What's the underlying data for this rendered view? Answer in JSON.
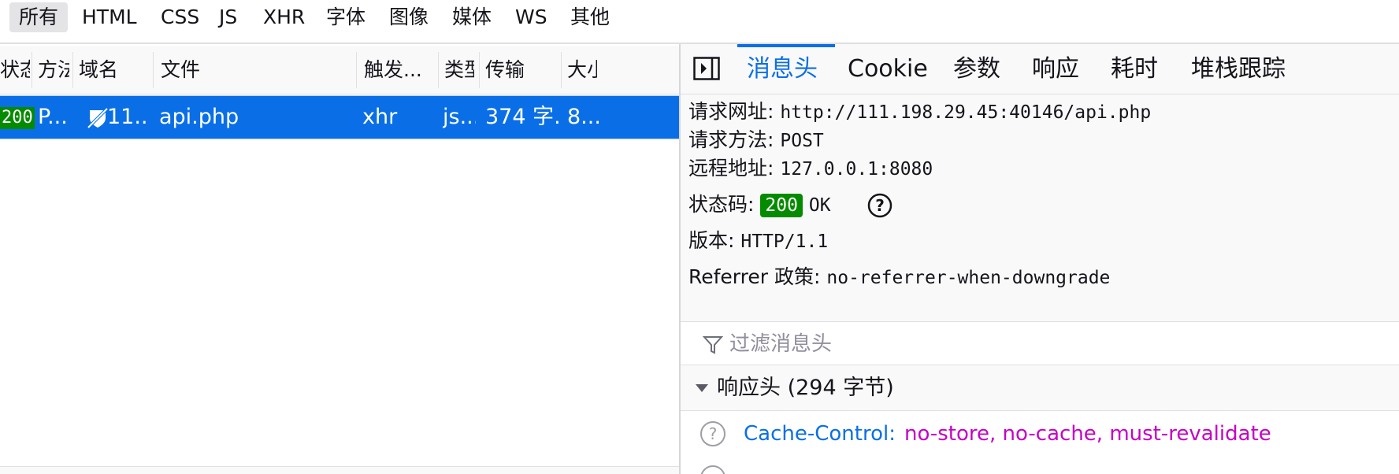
{
  "filters": {
    "items": [
      "所有",
      "HTML",
      "CSS",
      "JS",
      "XHR",
      "字体",
      "图像",
      "媒体",
      "WS",
      "其他"
    ],
    "active_index": 0
  },
  "table": {
    "columns": [
      "状态",
      "方法",
      "域名",
      "文件",
      "触发...",
      "类型",
      "传输",
      "大小"
    ],
    "selected_row": {
      "status": "200",
      "method": "P...",
      "domain": "11...",
      "file": "api.php",
      "initiator": "xhr",
      "type": "js...",
      "transferred": "374 字...",
      "size": "8..."
    }
  },
  "details": {
    "tabs": [
      "消息头",
      "Cookie",
      "参数",
      "响应",
      "耗时",
      "堆栈跟踪"
    ],
    "active_tab_index": 0,
    "summary": {
      "request_url_label": "请求网址:",
      "request_url": "http://111.198.29.45:40146/api.php",
      "method_label": "请求方法:",
      "method": "POST",
      "remote_label": "远程地址:",
      "remote": "127.0.0.1:8080",
      "status_label": "状态码:",
      "status_code": "200",
      "status_text": "OK",
      "version_label": "版本:",
      "version": "HTTP/1.1",
      "referrer_label": "Referrer 政策:",
      "referrer": "no-referrer-when-downgrade"
    },
    "filter_placeholder": "过滤消息头",
    "response_headers": {
      "title": "响应头 (294 字节)",
      "rows": [
        {
          "name": "Cache-Control:",
          "value": "no-store, no-cache, must-revalidate"
        }
      ]
    }
  },
  "colors": {
    "accent": "#0a6fe6",
    "selected_row": "#0a6fe6",
    "status_ok": "#058b00",
    "header_value": "#c600c6"
  },
  "icons": [
    "panel-toggle-icon",
    "tracker-blocked-icon",
    "help-icon",
    "filter-icon",
    "twisty-down-icon"
  ]
}
